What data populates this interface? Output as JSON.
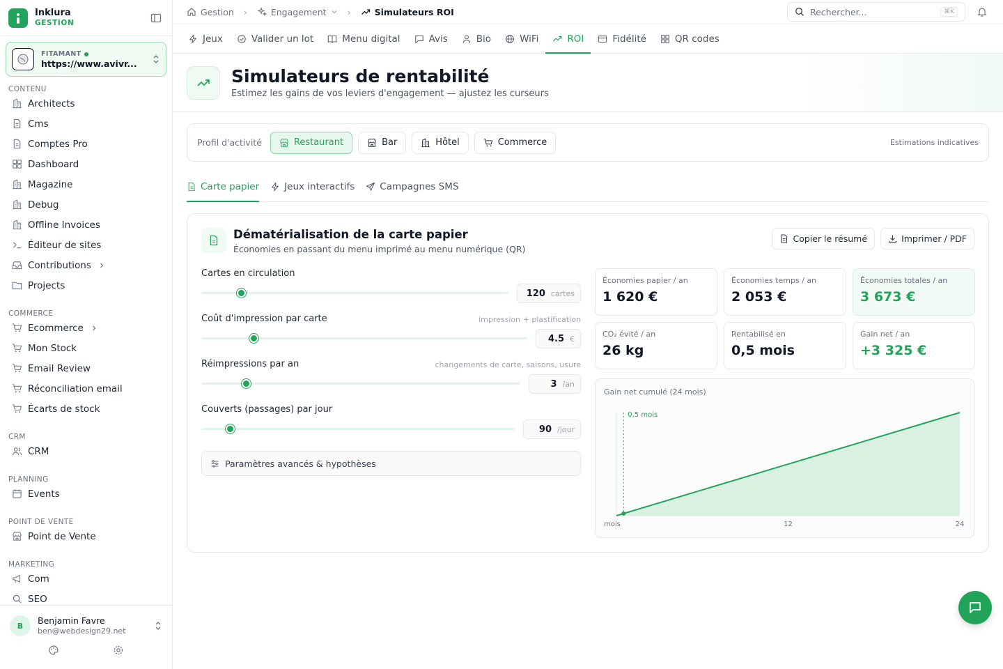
{
  "brand": {
    "name": "Inklura",
    "sub": "GESTION"
  },
  "site": {
    "label": "FITAMANT",
    "url": "https://www.avivr..."
  },
  "sidebar": {
    "sections": [
      {
        "title": "CONTENU",
        "items": [
          {
            "label": "Architects",
            "icon": "building-icon"
          },
          {
            "label": "Cms",
            "icon": "file-icon"
          },
          {
            "label": "Comptes Pro",
            "icon": "file-icon"
          },
          {
            "label": "Dashboard",
            "icon": "grid-icon"
          },
          {
            "label": "Magazine",
            "icon": "building-icon"
          },
          {
            "label": "Debug",
            "icon": "building-icon"
          },
          {
            "label": "Offline Invoices",
            "icon": "building-icon"
          },
          {
            "label": "Éditeur de sites",
            "icon": "terminal-icon"
          },
          {
            "label": "Contributions",
            "icon": "inbox-icon",
            "chevron": true
          },
          {
            "label": "Projects",
            "icon": "folder-icon"
          }
        ]
      },
      {
        "title": "COMMERCE",
        "items": [
          {
            "label": "Ecommerce",
            "icon": "cart-icon",
            "chevron": true
          },
          {
            "label": "Mon Stock",
            "icon": "cart-icon"
          },
          {
            "label": "Email Review",
            "icon": "cart-icon"
          },
          {
            "label": "Réconciliation email",
            "icon": "cart-icon"
          },
          {
            "label": "Écarts de stock",
            "icon": "cart-icon"
          }
        ]
      },
      {
        "title": "CRM",
        "items": [
          {
            "label": "CRM",
            "icon": "users-icon"
          }
        ]
      },
      {
        "title": "PLANNING",
        "items": [
          {
            "label": "Events",
            "icon": "calendar-icon"
          }
        ]
      },
      {
        "title": "POINT DE VENTE",
        "items": [
          {
            "label": "Point de Vente",
            "icon": "store-icon"
          }
        ]
      },
      {
        "title": "MARKETING",
        "items": [
          {
            "label": "Com",
            "icon": "megaphone-icon"
          },
          {
            "label": "SEO",
            "icon": "search-icon"
          }
        ]
      }
    ]
  },
  "user": {
    "initial": "B",
    "name": "Benjamin Favre",
    "email": "ben@webdesign29.net"
  },
  "breadcrumb": {
    "home": "Gestion",
    "section": "Engagement",
    "current": "Simulateurs ROI"
  },
  "search": {
    "placeholder": "Rechercher...",
    "shortcut": "⌘K"
  },
  "tabs": [
    {
      "label": "Jeux",
      "icon": "bolt-icon"
    },
    {
      "label": "Valider un lot",
      "icon": "check-circle-icon"
    },
    {
      "label": "Menu digital",
      "icon": "book-icon"
    },
    {
      "label": "Avis",
      "icon": "message-icon"
    },
    {
      "label": "Bio",
      "icon": "user-icon"
    },
    {
      "label": "WiFi",
      "icon": "globe-icon"
    },
    {
      "label": "ROI",
      "icon": "trend-icon",
      "active": true
    },
    {
      "label": "Fidélité",
      "icon": "card-icon"
    },
    {
      "label": "QR codes",
      "icon": "qr-icon"
    }
  ],
  "hero": {
    "title": "Simulateurs de rentabilité",
    "subtitle": "Estimez les gains de vos leviers d'engagement — ajustez les curseurs"
  },
  "profile": {
    "label": "Profil d'activité",
    "options": [
      {
        "label": "Restaurant",
        "icon": "store-icon",
        "active": true
      },
      {
        "label": "Bar",
        "icon": "store-icon"
      },
      {
        "label": "Hôtel",
        "icon": "building-icon"
      },
      {
        "label": "Commerce",
        "icon": "cart-icon"
      }
    ],
    "note": "Estimations indicatives"
  },
  "subtabs": [
    {
      "label": "Carte papier",
      "icon": "file-icon",
      "active": true
    },
    {
      "label": "Jeux interactifs",
      "icon": "bolt-icon"
    },
    {
      "label": "Campagnes SMS",
      "icon": "send-icon"
    }
  ],
  "card": {
    "title": "Dématérialisation de la carte papier",
    "subtitle": "Économies en passant du menu imprimé au menu numérique (QR)",
    "copy_label": "Copier le résumé",
    "print_label": "Imprimer / PDF"
  },
  "controls": [
    {
      "label": "Cartes en circulation",
      "hint": "",
      "value": "120",
      "unit": "cartes",
      "fraction": 0.13
    },
    {
      "label": "Coût d'impression par carte",
      "hint": "impression + plastification",
      "value": "4.5",
      "unit": "€",
      "fraction": 0.16
    },
    {
      "label": "Réimpressions par an",
      "hint": "changements de carte, saisons, usure",
      "value": "3",
      "unit": "/an",
      "fraction": 0.14
    },
    {
      "label": "Couverts (passages) par jour",
      "hint": "",
      "value": "90",
      "unit": "/jour",
      "fraction": 0.09
    }
  ],
  "advanced_label": "Paramètres avancés & hypothèses",
  "stats": [
    {
      "label": "Économies papier / an",
      "value": "1 620 €",
      "highlight": false
    },
    {
      "label": "Économies temps / an",
      "value": "2 053 €",
      "highlight": false
    },
    {
      "label": "Économies totales / an",
      "value": "3 673 €",
      "highlight": true
    },
    {
      "label": "CO₂ évité / an",
      "value": "26 kg",
      "highlight": false
    },
    {
      "label": "Rentabilisé en",
      "value": "0,5 mois",
      "highlight": false
    },
    {
      "label": "Gain net / an",
      "value": "+3 325 €",
      "highlight": true
    }
  ],
  "chart_data": {
    "type": "area",
    "title": "Gain net cumulé (24 mois)",
    "x": [
      0,
      24
    ],
    "y": [
      0,
      6650
    ],
    "xlabel": "mois",
    "xticks": [
      "12",
      "24"
    ],
    "xlim": [
      0,
      24
    ],
    "marker": {
      "x": 0.5,
      "label": "0,5 mois"
    },
    "colors": {
      "line": "#22a35a",
      "fill": "#d6f0df"
    }
  },
  "colors": {
    "accent": "#22a35a"
  }
}
